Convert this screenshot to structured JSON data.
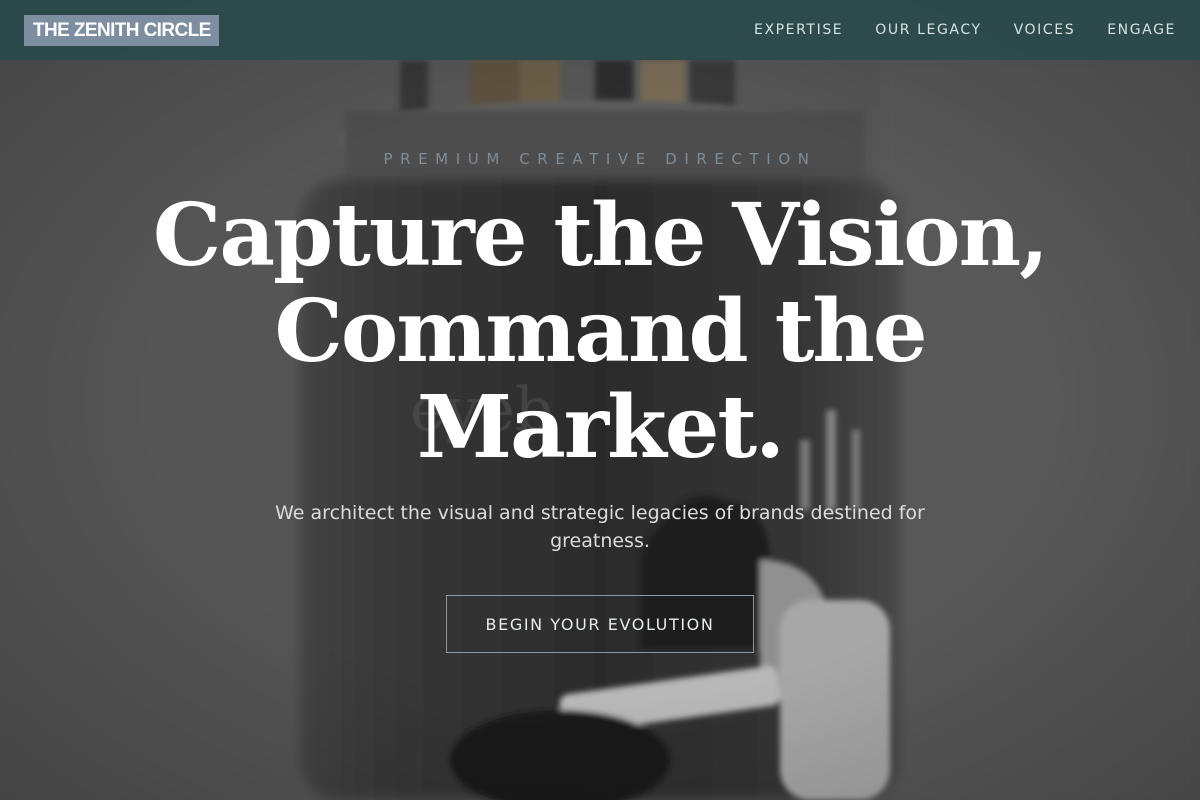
{
  "brand": {
    "name": "THE ZENITH CIRCLE"
  },
  "nav": {
    "items": [
      {
        "label": "EXPERTISE"
      },
      {
        "label": "OUR LEGACY"
      },
      {
        "label": "VOICES"
      },
      {
        "label": "ENGAGE"
      }
    ]
  },
  "hero": {
    "eyebrow": "PREMIUM CREATIVE DIRECTION",
    "headline_lines": [
      "Capture the Vision,",
      "Command the",
      "Market."
    ],
    "subhead": "We architect the visual and strategic legacies of brands destined for greatness.",
    "cta_label": "BEGIN YOUR EVOLUTION",
    "background_image": "brush-jar-and-woman-photo"
  },
  "colors": {
    "nav_background": "#2a4a4c",
    "brand_badge": "#7d8ea0",
    "eyebrow_text": "#7c8c98",
    "headline_text": "#ffffff",
    "cta_border": "#8a9aa2"
  }
}
